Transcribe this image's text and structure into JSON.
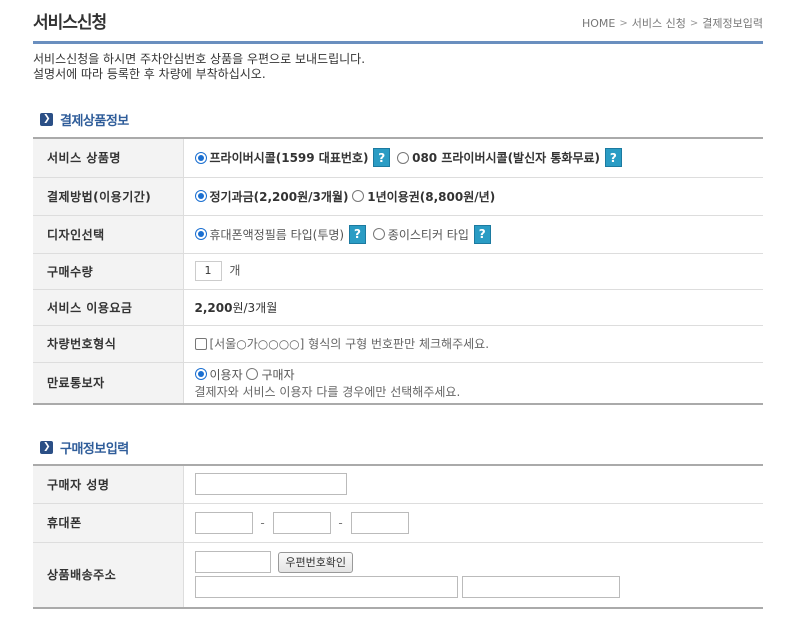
{
  "page": {
    "title": "서비스신청"
  },
  "breadcrumb": [
    "HOME",
    "서비스 신청",
    "결제정보입력"
  ],
  "intro": {
    "line1": "서비스신청을 하시면 주차안심번호 상품을 우편으로 보내드립니다.",
    "line2": "설명서에 따라 등록한 후 차량에 부착하십시오."
  },
  "section1": {
    "title": "결제상품정보",
    "rows": {
      "service": {
        "label": "서비스 상품명",
        "opt1": "프라이버시콜(1599 대표번호)",
        "opt2": "080 프라이버시콜(발신자 통화무료)"
      },
      "payment": {
        "label": "결제방법(이용기간)",
        "opt1": "정기과금(2,200원/3개월)",
        "opt2": "1년이용권(8,800원/년)"
      },
      "design": {
        "label": "디자인선택",
        "opt1": "휴대폰액정필름 타입(투명)",
        "opt2": "종이스티커 타입"
      },
      "quantity": {
        "label": "구매수량",
        "value": "1",
        "unit": "개"
      },
      "fee": {
        "label": "서비스 이용요금",
        "amount": "2,200",
        "unit": "원/3개월"
      },
      "plate": {
        "label": "차량번호형식",
        "text": "[서울○가○○○○] 형식의 구형 번호판만 체크해주세요."
      },
      "notify": {
        "label": "만료통보자",
        "opt1": "이용자",
        "opt2": "구매자",
        "note": "결제자와 서비스 이용자 다를 경우에만 선택해주세요."
      }
    },
    "help_symbol": "?"
  },
  "section2": {
    "title": "구매정보입력",
    "rows": {
      "name": {
        "label": "구매자 성명"
      },
      "phone": {
        "label": "휴대폰",
        "separator": "-"
      },
      "address": {
        "label": "상품배송주소",
        "zip_button": "우편번호확인"
      }
    }
  },
  "colors": {
    "accent": "#2f5d9a",
    "header_rule": "#6a8fbf",
    "help_button": "#2a9cc4",
    "radio_selected": "#1a6fd1"
  },
  "icons": {
    "section_bullet": "chevron-right-icon",
    "breadcrumb_separator": "chevron-right-icon"
  }
}
